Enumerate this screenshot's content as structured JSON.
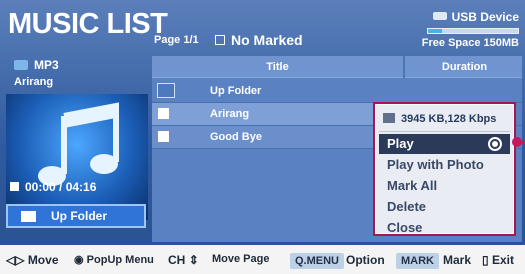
{
  "header": {
    "title": "MUSIC LIST",
    "page_info": "Page 1/1",
    "marked_label": "No Marked",
    "device_label": "USB Device",
    "free_space": "Free Space 150MB",
    "usage_fraction": 0.15
  },
  "left_panel": {
    "type": "MP3",
    "song": "Arirang",
    "time": "00:00 / 04:16",
    "up_folder_button": "Up Folder"
  },
  "list": {
    "columns": [
      "Title",
      "Duration"
    ],
    "rows": [
      {
        "name": "Up Folder",
        "type": "folder"
      },
      {
        "name": "Arirang",
        "type": "file",
        "selected": true
      },
      {
        "name": "Good Bye",
        "type": "file"
      }
    ]
  },
  "popup": {
    "info": "3945 KB,128 Kbps",
    "items": [
      "Play",
      "Play with Photo",
      "Mark All",
      "Delete",
      "Close"
    ],
    "active_index": 0
  },
  "footer": {
    "move": "Move",
    "popup_menu": "PopUp Menu",
    "ch": "CH",
    "move_page": "Move Page",
    "qmenu": "Q.MENU",
    "option": "Option",
    "mark_key": "MARK",
    "mark": "Mark",
    "exit": "Exit"
  },
  "colors": {
    "background": "#2f5a9e",
    "popup_border": "#a91550",
    "accent": "#4fb0e6"
  }
}
